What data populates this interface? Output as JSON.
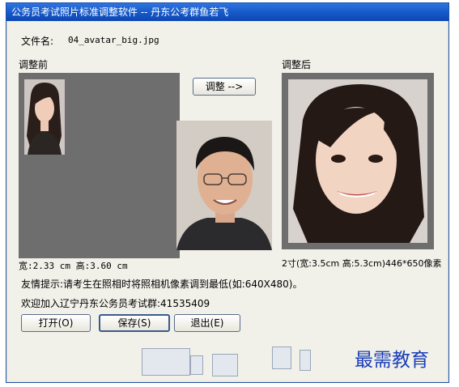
{
  "window": {
    "title": "公务员考试照片标准调整软件 -- 丹东公考群鱼若飞"
  },
  "file": {
    "label": "文件名:",
    "name": "04_avatar_big.jpg"
  },
  "before": {
    "label": "调整前",
    "dims": "宽:2.33 cm 高:3.60 cm"
  },
  "after": {
    "label": "调整后",
    "spec": "2寸(宽:3.5cm 高:5.3cm)446*650像素"
  },
  "buttons": {
    "adjust": "调整 -->",
    "open": "打开(O)",
    "save": "保存(S)",
    "exit": "退出(E)"
  },
  "tips": {
    "line1": "友情提示:请考生在照相时将照相机像素调到最低(如:640X480)。",
    "line2": "欢迎加入辽宁丹东公务员考试群:41535409"
  },
  "watermark": "最需教育"
}
